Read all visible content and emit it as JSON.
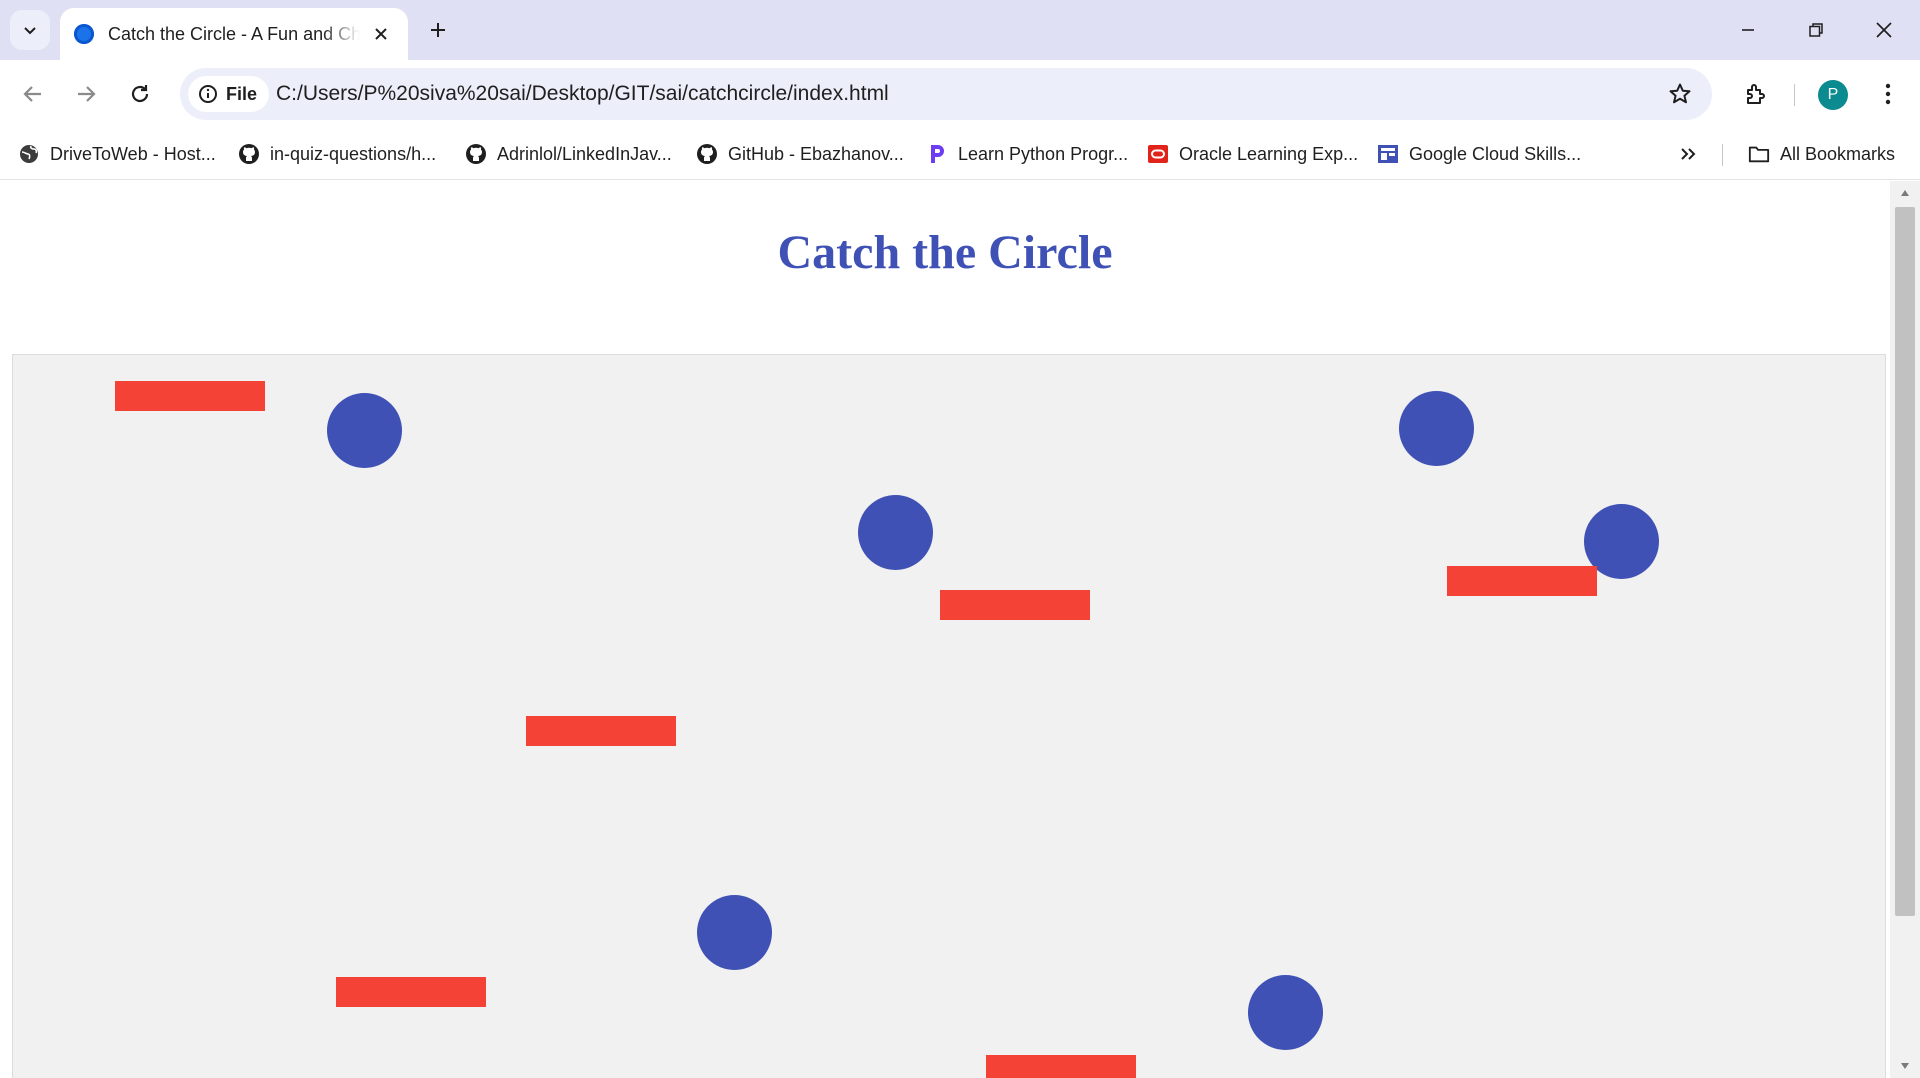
{
  "browser": {
    "tab": {
      "title": "Catch the Circle - A Fun and Challenging Game",
      "favicon": "globe-icon"
    },
    "window_controls": [
      "minimize-icon",
      "restore-icon",
      "close-icon"
    ],
    "address": {
      "chip_label": "File",
      "url": "C:/Users/P%20siva%20sai/Desktop/GIT/sai/catchcircle/index.html"
    },
    "profile_initial": "P",
    "bookmarks": [
      {
        "label": "DriveToWeb - Host...",
        "icon": "globe-icon"
      },
      {
        "label": "in-quiz-questions/h...",
        "icon": "github-icon"
      },
      {
        "label": "Adrinlol/LinkedInJav...",
        "icon": "github-icon"
      },
      {
        "label": "GitHub - Ebazhanov...",
        "icon": "github-icon"
      },
      {
        "label": "Learn Python Progr...",
        "icon": "programiz-icon"
      },
      {
        "label": "Oracle Learning Exp...",
        "icon": "oracle-icon"
      },
      {
        "label": "Google Cloud Skills...",
        "icon": "cloud-skills-icon"
      }
    ],
    "all_bookmarks_label": "All Bookmarks"
  },
  "page": {
    "title": "Catch the Circle",
    "colors": {
      "title": "#3f51b5",
      "circle": "#3f51b5",
      "obstacle": "#f44336",
      "game_background": "#f1f1f1"
    },
    "game": {
      "circles_count": 6,
      "obstacles_count": 6
    }
  }
}
